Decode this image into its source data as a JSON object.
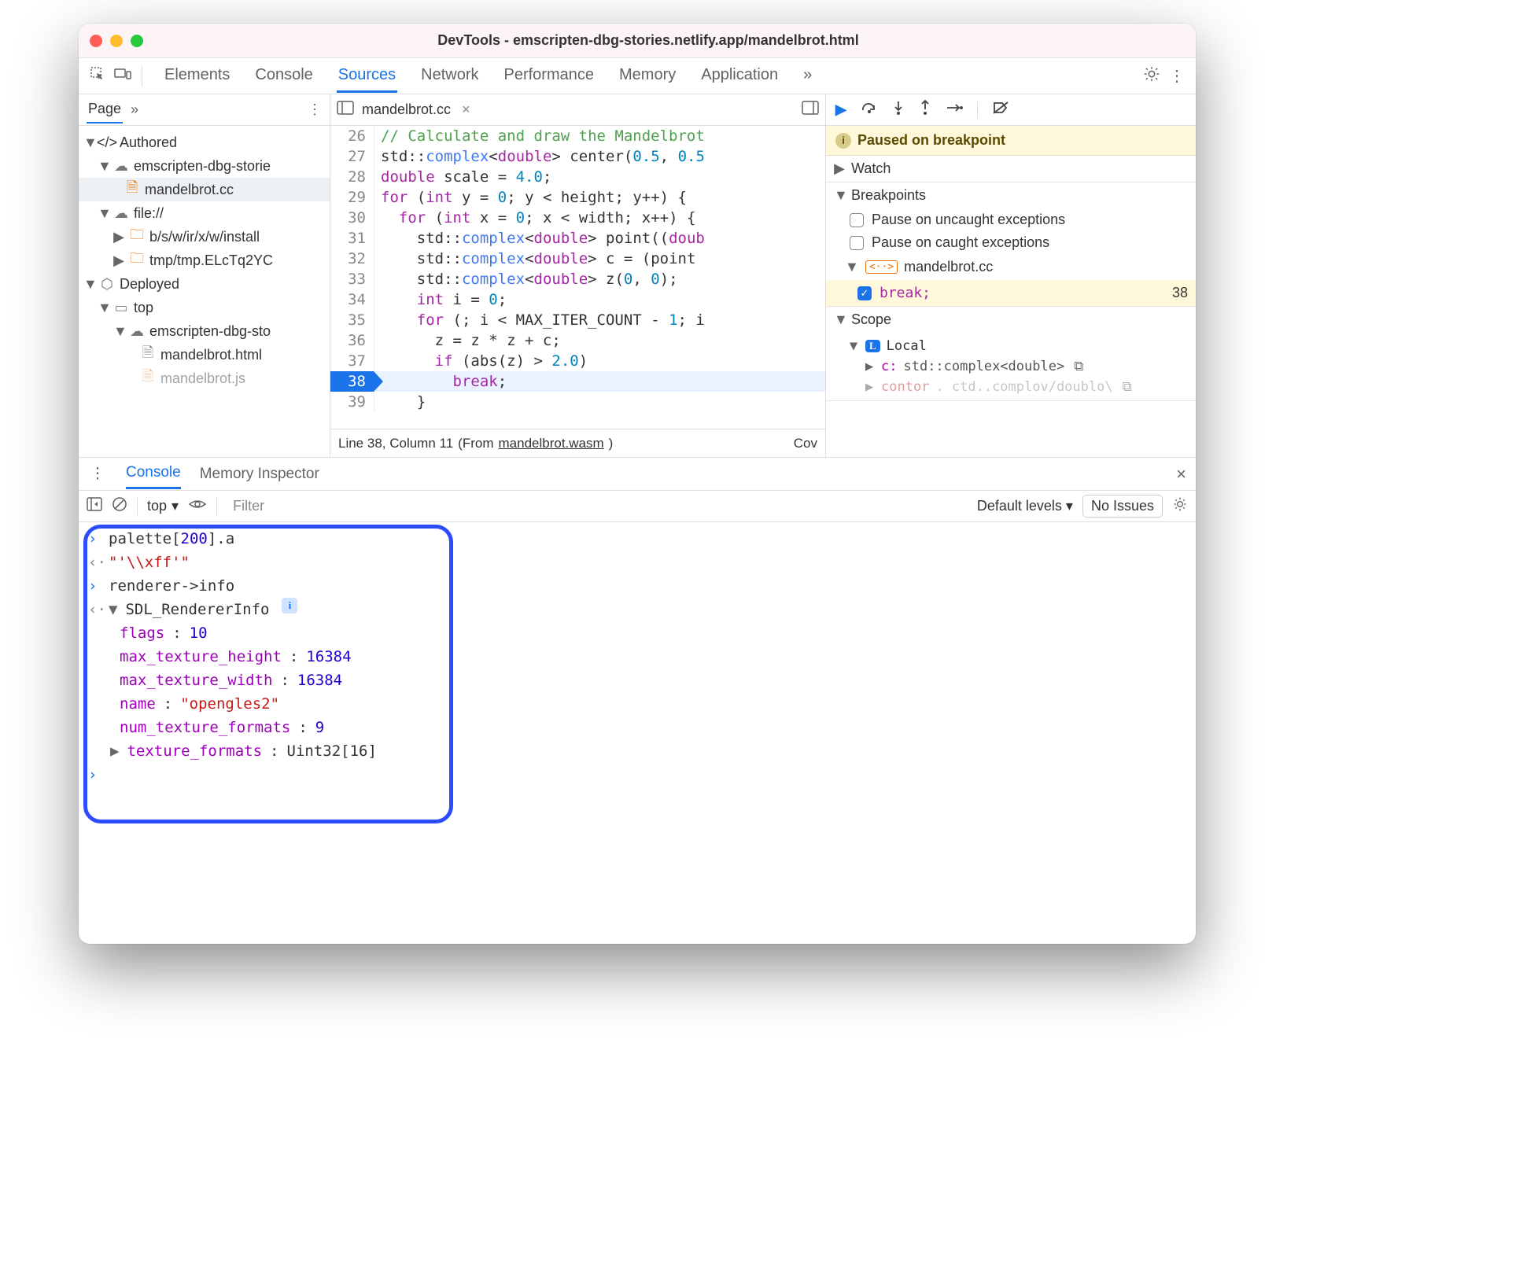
{
  "window": {
    "title": "DevTools - emscripten-dbg-stories.netlify.app/mandelbrot.html"
  },
  "tabs": [
    "Elements",
    "Console",
    "Sources",
    "Network",
    "Performance",
    "Memory",
    "Application"
  ],
  "active_tab": "Sources",
  "overflow_glyph": "»",
  "nav": {
    "page_label": "Page",
    "items": {
      "authored": "Authored",
      "dom0": "emscripten-dbg-storie",
      "file0": "mandelbrot.cc",
      "fileproto": "file://",
      "folder1": "b/s/w/ir/x/w/install",
      "folder2": "tmp/tmp.ELcTq2YC",
      "deployed": "Deployed",
      "top": "top",
      "dom1": "emscripten-dbg-sto",
      "file_html": "mandelbrot.html",
      "file_js": "mandelbrot.js"
    }
  },
  "editor": {
    "filename": "mandelbrot.cc",
    "lines": [
      {
        "n": 26,
        "html": "<span class='cm'>// Calculate and draw the Mandelbrot</span>"
      },
      {
        "n": 27,
        "html": "<span class='id'>std</span>::<span class='ty'>complex</span>&lt;<span class='kw'>double</span>&gt; center(<span class='num'>0.5</span>, <span class='num'>0.5</span>"
      },
      {
        "n": 28,
        "html": "<span class='kw'>double</span> scale = <span class='num'>4.0</span>;"
      },
      {
        "n": 29,
        "html": "<span class='kw'>for</span> (<span class='kw'>int</span> y = <span class='num'>0</span>; y &lt; height; y++) {"
      },
      {
        "n": 30,
        "html": "  <span class='kw'>for</span> (<span class='kw'>int</span> x = <span class='num'>0</span>; x &lt; width; x++) {"
      },
      {
        "n": 31,
        "html": "    <span class='id'>std</span>::<span class='ty'>complex</span>&lt;<span class='kw'>double</span>&gt; point((<span class='kw'>doub</span>"
      },
      {
        "n": 32,
        "html": "    <span class='id'>std</span>::<span class='ty'>complex</span>&lt;<span class='kw'>double</span>&gt; c = (point"
      },
      {
        "n": 33,
        "html": "    <span class='id'>std</span>::<span class='ty'>complex</span>&lt;<span class='kw'>double</span>&gt; z(<span class='num'>0</span>, <span class='num'>0</span>);"
      },
      {
        "n": 34,
        "html": "    <span class='kw'>int</span> i = <span class='num'>0</span>;"
      },
      {
        "n": 35,
        "html": "    <span class='kw'>for</span> (; i &lt; MAX_ITER_COUNT - <span class='num'>1</span>; i"
      },
      {
        "n": 36,
        "html": "      z = z * z + c;"
      },
      {
        "n": 37,
        "html": "      <span class='kw'>if</span> (abs(z) &gt; <span class='num'>2.0</span>)"
      },
      {
        "n": 38,
        "html": "        <span class='kw'>break</span>;",
        "hl": true
      },
      {
        "n": 39,
        "html": "    }"
      }
    ],
    "status_line": "Line 38, Column 11",
    "status_from_pre": "(From ",
    "status_from_file": "mandelbrot.wasm",
    "status_from_post": ")",
    "status_cov": "Cov"
  },
  "debugger": {
    "paused": "Paused on breakpoint",
    "watch": "Watch",
    "breakpoints": "Breakpoints",
    "bp_uncaught": "Pause on uncaught exceptions",
    "bp_caught": "Pause on caught exceptions",
    "bp_file": "mandelbrot.cc",
    "bp_code": "break;",
    "bp_line": "38",
    "scope": "Scope",
    "local": "Local",
    "vars": [
      {
        "k": "c:",
        "t": "std::complex<double>"
      },
      {
        "k2": "contor",
        "t2": ". ctd..complov/doublo\\"
      }
    ]
  },
  "drawer": {
    "tabs": [
      "Console",
      "Memory Inspector"
    ],
    "toolbar": {
      "context": "top",
      "filter_placeholder": "Filter",
      "levels": "Default levels",
      "issues": "No Issues"
    },
    "console": {
      "in1_a": "palette[",
      "in1_b": "200",
      "in1_c": "].a",
      "out1": "\"'\\\\xff'\"",
      "in2": "renderer->info",
      "obj_name": "SDL_RendererInfo",
      "flags_k": "flags",
      "flags_v": "10",
      "mth_k": "max_texture_height",
      "mth_v": "16384",
      "mtw_k": "max_texture_width",
      "mtw_v": "16384",
      "name_k": "name",
      "name_v": "\"opengles2\"",
      "ntf_k": "num_texture_formats",
      "ntf_v": "9",
      "tf_k": "texture_formats",
      "tf_v": "Uint32[16]"
    }
  }
}
